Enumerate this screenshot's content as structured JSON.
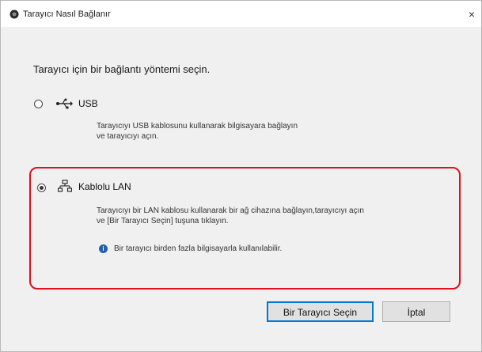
{
  "window": {
    "title": "Tarayıcı Nasıl Bağlanır"
  },
  "prompt": "Tarayıcı için bir bağlantı yöntemi seçin.",
  "options": [
    {
      "label": "USB",
      "description": [
        "Tarayıcıyı USB kablosunu kullanarak bilgisayara bağlayın",
        "ve tarayıcıyı açın."
      ],
      "selected": false
    },
    {
      "label": "Kablolu LAN",
      "description": [
        "Tarayıcıyı bir LAN kablosu kullanarak bir ağ cihazına bağlayın,tarayıcıyı açın",
        "ve [Bir Tarayıcı Seçin] tuşuna tıklayın."
      ],
      "info": "Bir tarayıcı birden fazla bilgisayarla kullanılabilir.",
      "selected": true
    }
  ],
  "buttons": {
    "select": "Bir Tarayıcı Seçin",
    "cancel": "İptal"
  },
  "icons": {
    "close": "×"
  },
  "colors": {
    "highlight": "#e0101e",
    "info": "#1e5fb4",
    "default_button_border": "#0078d7"
  }
}
